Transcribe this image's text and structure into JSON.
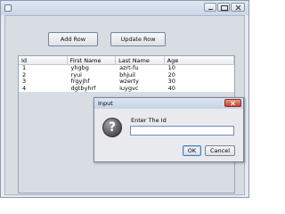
{
  "window": {
    "title": ""
  },
  "toolbar": {
    "add_row_label": "Add Row",
    "update_row_label": "Update Row"
  },
  "table": {
    "columns": [
      "Id",
      "First Name",
      "Last Name",
      "Age"
    ],
    "rows": [
      [
        "1",
        "yhgbg",
        "azrt-fu",
        "10"
      ],
      [
        "2",
        "ryui",
        "bhjuil",
        "20"
      ],
      [
        "3",
        "frgyjhf",
        "wzerty",
        "30"
      ],
      [
        "4",
        "dgtbyhrf",
        "iuygvc",
        "40"
      ]
    ]
  },
  "dialog": {
    "title": "Input",
    "icon": "question-icon",
    "prompt": "Enter The Id",
    "input_value": "",
    "ok_label": "OK",
    "cancel_label": "Cancel"
  },
  "colors": {
    "window_bg": "#e7eaf0",
    "panel_bg": "#d8dde4",
    "close_button": "#c6402c",
    "input_border": "#6f8cb8"
  }
}
